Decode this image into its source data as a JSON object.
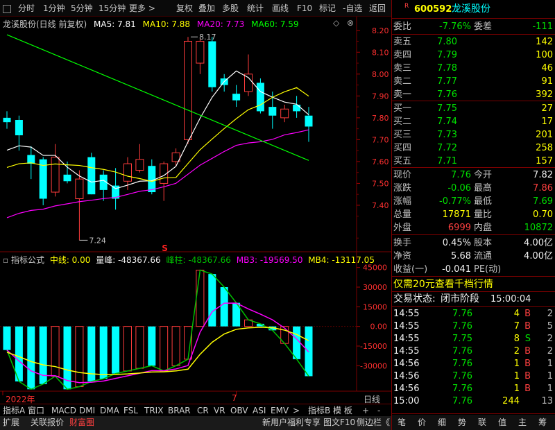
{
  "toolbar": {
    "items": [
      "分时",
      "1分钟",
      "5分钟",
      "15分钟",
      "更多 >",
      "复权",
      "叠加",
      "多股",
      "统计",
      "画线",
      "F10",
      "标记",
      "-自选",
      "返回"
    ]
  },
  "main_info": {
    "title": "龙溪股份(日线 前复权)",
    "ma5": "MA5: 7.81",
    "ma10": "MA10: 7.88",
    "ma20": "MA20: 7.73",
    "ma60": "MA60: 7.59",
    "high_label": "8.17",
    "low_label": "7.24",
    "s_marker": "S",
    "colors": {
      "ma5": "#ffffff",
      "ma10": "#ffff00",
      "ma20": "#ff00ff",
      "ma60": "#00ff00",
      "up": "#ff3c3c",
      "down": "#00ffff"
    }
  },
  "price_axis": [
    "8.20",
    "8.10",
    "8.00",
    "7.90",
    "7.80",
    "7.70",
    "7.60",
    "7.50",
    "7.40"
  ],
  "indicator": {
    "name": "指标公式",
    "zhongxian": "中线: 0.00",
    "liangfeng": "量峰: -48367.66",
    "fengzhu": "峰柱: -48367.66",
    "mb3": "MB3: -19569.50",
    "mb4": "MB4: -13117.05",
    "axis": [
      "45000",
      "30000",
      "15000",
      "0.00",
      "-15000",
      "-30000"
    ]
  },
  "chart_data": [
    {
      "type": "candlestick",
      "title": "龙溪股份(日线 前复权)",
      "ylim": [
        7.2,
        8.25
      ],
      "candles": [
        {
          "o": 7.8,
          "h": 7.83,
          "l": 7.75,
          "c": 7.78
        },
        {
          "o": 7.79,
          "h": 7.81,
          "l": 7.65,
          "c": 7.72
        },
        {
          "o": 7.63,
          "h": 7.67,
          "l": 7.52,
          "c": 7.59
        },
        {
          "o": 7.61,
          "h": 7.62,
          "l": 7.4,
          "c": 7.43
        },
        {
          "o": 7.46,
          "h": 7.68,
          "l": 7.44,
          "c": 7.62
        },
        {
          "o": 7.54,
          "h": 7.6,
          "l": 7.5,
          "c": 7.51
        },
        {
          "o": 7.43,
          "h": 7.56,
          "l": 7.24,
          "c": 7.52
        },
        {
          "o": 7.62,
          "h": 7.64,
          "l": 7.45,
          "c": 7.45
        },
        {
          "o": 7.54,
          "h": 7.56,
          "l": 7.42,
          "c": 7.47
        },
        {
          "o": 7.49,
          "h": 7.57,
          "l": 7.38,
          "c": 7.43
        },
        {
          "o": 7.51,
          "h": 7.62,
          "l": 7.47,
          "c": 7.59
        },
        {
          "o": 7.56,
          "h": 7.68,
          "l": 7.55,
          "c": 7.61
        },
        {
          "o": 7.58,
          "h": 7.61,
          "l": 7.45,
          "c": 7.46
        },
        {
          "o": 7.5,
          "h": 7.6,
          "l": 7.42,
          "c": 7.59
        },
        {
          "o": 7.6,
          "h": 7.66,
          "l": 7.58,
          "c": 7.64
        },
        {
          "o": 7.7,
          "h": 8.17,
          "l": 7.68,
          "c": 8.15
        },
        {
          "o": 8.05,
          "h": 8.16,
          "l": 8.0,
          "c": 8.15
        },
        {
          "o": 8.15,
          "h": 8.17,
          "l": 7.92,
          "c": 7.94
        },
        {
          "o": 7.98,
          "h": 8.0,
          "l": 7.92,
          "c": 7.95
        },
        {
          "o": 7.91,
          "h": 7.95,
          "l": 7.85,
          "c": 7.88
        },
        {
          "o": 7.92,
          "h": 8.09,
          "l": 7.9,
          "c": 8.0
        },
        {
          "o": 7.96,
          "h": 7.98,
          "l": 7.82,
          "c": 7.83
        },
        {
          "o": 7.85,
          "h": 7.92,
          "l": 7.75,
          "c": 7.81
        },
        {
          "o": 7.8,
          "h": 7.86,
          "l": 7.78,
          "c": 7.84
        },
        {
          "o": 7.86,
          "h": 7.9,
          "l": 7.8,
          "c": 7.83
        },
        {
          "o": 7.81,
          "h": 7.85,
          "l": 7.69,
          "c": 7.76
        }
      ]
    },
    {
      "type": "bar",
      "title": "指标公式",
      "ylim": [
        -48367.66,
        45000
      ],
      "values": [
        -18000,
        -42000,
        -48000,
        -44000,
        -38000,
        -48000,
        -46000,
        -42000,
        -40000,
        -36000,
        -34000,
        -32000,
        -30000,
        -34000,
        -30000,
        -25000,
        43000,
        40000,
        30000,
        18000,
        5000,
        2000,
        -3000,
        -13000,
        -25000,
        -38000
      ]
    }
  ],
  "bottom_tabs": [
    "指标A",
    "窗口",
    "MACD",
    "DMI",
    "DMA",
    "FSL",
    "TRIX",
    "BRAR",
    "CR",
    "VR",
    "OBV",
    "ASI",
    "EMV",
    ">",
    "指标B",
    "模 板",
    "+",
    "-"
  ],
  "bottom_left": [
    "扩展",
    "关联报价",
    "财富圈"
  ],
  "bottom_right": [
    "新用户福利专享",
    "图文F10",
    "侧边栏《"
  ],
  "year_label": "2022年",
  "month_label": "7",
  "period_label": "日线",
  "right": {
    "code": "600592",
    "name": "龙溪股份",
    "r_badge": "R",
    "weibi_label": "委比",
    "weibi": "-7.76%",
    "weicha_label": "委差",
    "weicha": "-111",
    "asks": [
      {
        "label": "卖五",
        "price": "7.80",
        "vol": "142"
      },
      {
        "label": "卖四",
        "price": "7.79",
        "vol": "100"
      },
      {
        "label": "卖三",
        "price": "7.78",
        "vol": "46"
      },
      {
        "label": "卖二",
        "price": "7.77",
        "vol": "91"
      },
      {
        "label": "卖一",
        "price": "7.76",
        "vol": "392"
      }
    ],
    "bids": [
      {
        "label": "买一",
        "price": "7.75",
        "vol": "27"
      },
      {
        "label": "买二",
        "price": "7.74",
        "vol": "17"
      },
      {
        "label": "买三",
        "price": "7.73",
        "vol": "201"
      },
      {
        "label": "买四",
        "price": "7.72",
        "vol": "258"
      },
      {
        "label": "买五",
        "price": "7.71",
        "vol": "157"
      }
    ],
    "stats": [
      {
        "l1": "现价",
        "v1": "7.76",
        "l2": "今开",
        "v2": "7.82"
      },
      {
        "l1": "涨跌",
        "v1": "-0.06",
        "l2": "最高",
        "v2": "7.86"
      },
      {
        "l1": "涨幅",
        "v1": "-0.77%",
        "l2": "最低",
        "v2": "7.69"
      },
      {
        "l1": "总量",
        "v1": "17871",
        "l2": "量比",
        "v2": "0.70"
      },
      {
        "l1": "外盘",
        "v1": "6999",
        "l2": "内盘",
        "v2": "10872"
      }
    ],
    "stats2": [
      {
        "l1": "换手",
        "v1": "0.45%",
        "l2": "股本",
        "v2": "4.00亿"
      },
      {
        "l1": "净资",
        "v1": "5.68",
        "l2": "流通",
        "v2": "4.00亿"
      },
      {
        "l1": "收益(一)",
        "v1": "-0.041",
        "l2": "PE(动)",
        "v2": ""
      }
    ],
    "promo": "仅需20元查看千档行情",
    "trade_status_label": "交易状态:",
    "trade_status": "闭市阶段",
    "trade_time": "15:00:04",
    "ticks": [
      {
        "t": "14:55",
        "p": "7.76",
        "v": "4",
        "bs": "B",
        "n": "2"
      },
      {
        "t": "14:55",
        "p": "7.76",
        "v": "7",
        "bs": "B",
        "n": "5"
      },
      {
        "t": "14:55",
        "p": "7.75",
        "v": "8",
        "bs": "S",
        "n": "2"
      },
      {
        "t": "14:55",
        "p": "7.76",
        "v": "2",
        "bs": "B",
        "n": "2"
      },
      {
        "t": "14:56",
        "p": "7.76",
        "v": "1",
        "bs": "B",
        "n": "1"
      },
      {
        "t": "14:56",
        "p": "7.76",
        "v": "1",
        "bs": "B",
        "n": "1"
      },
      {
        "t": "14:56",
        "p": "7.76",
        "v": "1",
        "bs": "B",
        "n": "1"
      },
      {
        "t": "15:00",
        "p": "7.76",
        "v": "244",
        "bs": "",
        "n": "13"
      }
    ],
    "bottom_tabs": [
      "笔",
      "价",
      "细",
      "势",
      "联",
      "值",
      "主",
      "筹"
    ]
  }
}
